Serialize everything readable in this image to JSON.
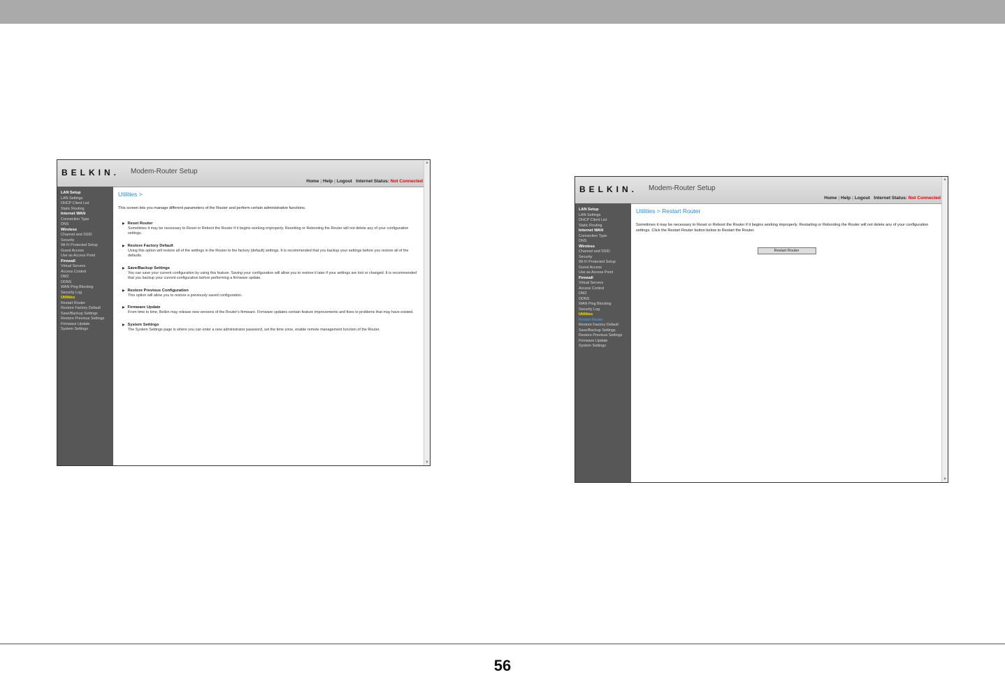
{
  "page_number": "56",
  "shared": {
    "logo": "BELKIN.",
    "app_title": "Modem-Router Setup",
    "nav": {
      "home": "Home",
      "help": "Help",
      "logout": "Logout",
      "sep": "|",
      "status_label": "Internet Status:",
      "status_value": "Not Connected"
    },
    "sidebar": [
      {
        "kind": "sec",
        "label": "LAN Setup"
      },
      {
        "kind": "item",
        "label": "LAN Settings"
      },
      {
        "kind": "item",
        "label": "DHCP Client List"
      },
      {
        "kind": "item",
        "label": "Static Routing"
      },
      {
        "kind": "sec",
        "label": "Internet WAN"
      },
      {
        "kind": "item",
        "label": "Connection Type"
      },
      {
        "kind": "item",
        "label": "DNS"
      },
      {
        "kind": "sec",
        "label": "Wireless"
      },
      {
        "kind": "item",
        "label": "Channel and SSID"
      },
      {
        "kind": "item",
        "label": "Security"
      },
      {
        "kind": "item",
        "label": "Wi-Fi Protected Setup"
      },
      {
        "kind": "item",
        "label": "Guest Access"
      },
      {
        "kind": "item",
        "label": "Use as Access Point"
      },
      {
        "kind": "sec",
        "label": "Firewall"
      },
      {
        "kind": "item",
        "label": "Virtual Servers"
      },
      {
        "kind": "item",
        "label": "Access Control"
      },
      {
        "kind": "item",
        "label": "DMZ"
      },
      {
        "kind": "item",
        "label": "DDNS"
      },
      {
        "kind": "item",
        "label": "WAN Ping Blocking"
      },
      {
        "kind": "item",
        "label": "Security Log"
      },
      {
        "kind": "sec",
        "label": "Utilities"
      },
      {
        "kind": "item",
        "label": "Restart Router"
      },
      {
        "kind": "item",
        "label": "Restore Factory Default"
      },
      {
        "kind": "item",
        "label": "Save/Backup Settings"
      },
      {
        "kind": "item",
        "label": "Restore Previous Settings"
      },
      {
        "kind": "item",
        "label": "Firmware Update"
      },
      {
        "kind": "item",
        "label": "System Settings"
      }
    ]
  },
  "left_screen": {
    "title": "Utilities >",
    "intro": "This screen lets you manage different parameters of the Router and perform certain administrative functions.",
    "options": [
      {
        "title": "Reset Router",
        "desc": "Sometimes it may be necessary to Reset or Reboot the Router if it begins working improperly. Resetting or Rebooting the Router will not delete any of your configuration settings."
      },
      {
        "title": "Restore Factory Default",
        "desc": "Using this option will restore all of the settings in the Router to the factory (default) settings. It is recommended that you backup your settings before you restore all of the defaults."
      },
      {
        "title": "Save/Backup Settings",
        "desc": "You can save your current configuration by using this feature. Saving your configuration will allow you to restore it later if your settings are lost or changed. It is recommended that you backup your current configuration before performing a firmware update."
      },
      {
        "title": "Restore Previous Configuration",
        "desc": "This option will allow you to restore a previously saved configuration."
      },
      {
        "title": "Firmware Update",
        "desc": "From time to time, Belkin may release new versions of the Router's firmware. Firmware updates contain feature improvements and fixes to problems that may have existed."
      },
      {
        "title": "System Settings",
        "desc": "The System Settings page is where you can enter a new administrator password, set the time zone, enable remote management function of the Router."
      }
    ]
  },
  "right_screen": {
    "title": "Utilities > Restart Router",
    "intro": "Sometimes it may be necessary to Reset or Reboot the Router if it begins working improperly. Restarting or Rebooting the Router will not delete any of your configuration settings. Click the Restart Router button below to Restart the Router.",
    "button": "Restart Router",
    "current_item": "Restart Router"
  }
}
